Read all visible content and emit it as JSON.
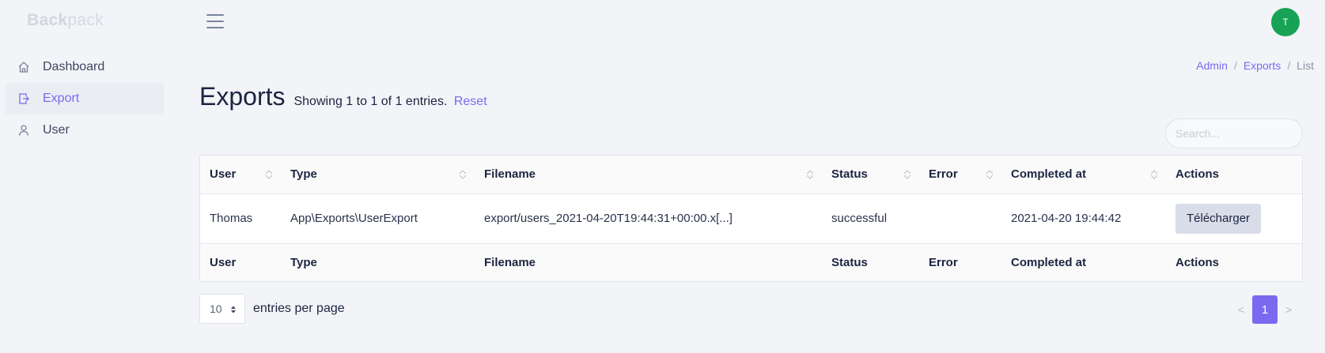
{
  "brand": {
    "bold": "Back",
    "rest": "pack"
  },
  "user": {
    "avatar_initial": "T"
  },
  "sidebar": {
    "items": [
      {
        "label": "Dashboard",
        "icon": "home-icon",
        "active": false
      },
      {
        "label": "Export",
        "icon": "export-icon",
        "active": true
      },
      {
        "label": "User",
        "icon": "user-icon",
        "active": false
      }
    ]
  },
  "breadcrumb": {
    "items": [
      "Admin",
      "Exports",
      "List"
    ],
    "separator": "/"
  },
  "page": {
    "title": "Exports",
    "subtitle": "Showing 1 to 1 of 1 entries.",
    "reset_label": "Reset"
  },
  "search": {
    "placeholder": "Search..."
  },
  "table": {
    "columns": [
      "User",
      "Type",
      "Filename",
      "Status",
      "Error",
      "Completed at",
      "Actions"
    ],
    "rows": [
      {
        "user": "Thomas",
        "type": "App\\Exports\\UserExport",
        "filename": "export/users_2021-04-20T19:44:31+00:00.x[...]",
        "status": "successful",
        "error": "",
        "completed_at": "2021-04-20 19:44:42",
        "action_label": "Télécharger"
      }
    ]
  },
  "pagination": {
    "per_page_value": "10",
    "per_page_label": "entries per page",
    "prev": "<",
    "current": "1",
    "next": ">"
  },
  "colors": {
    "accent": "#7c69ef",
    "avatar": "#16a355",
    "background": "#f3f4f8",
    "button": "#d8dde9"
  }
}
